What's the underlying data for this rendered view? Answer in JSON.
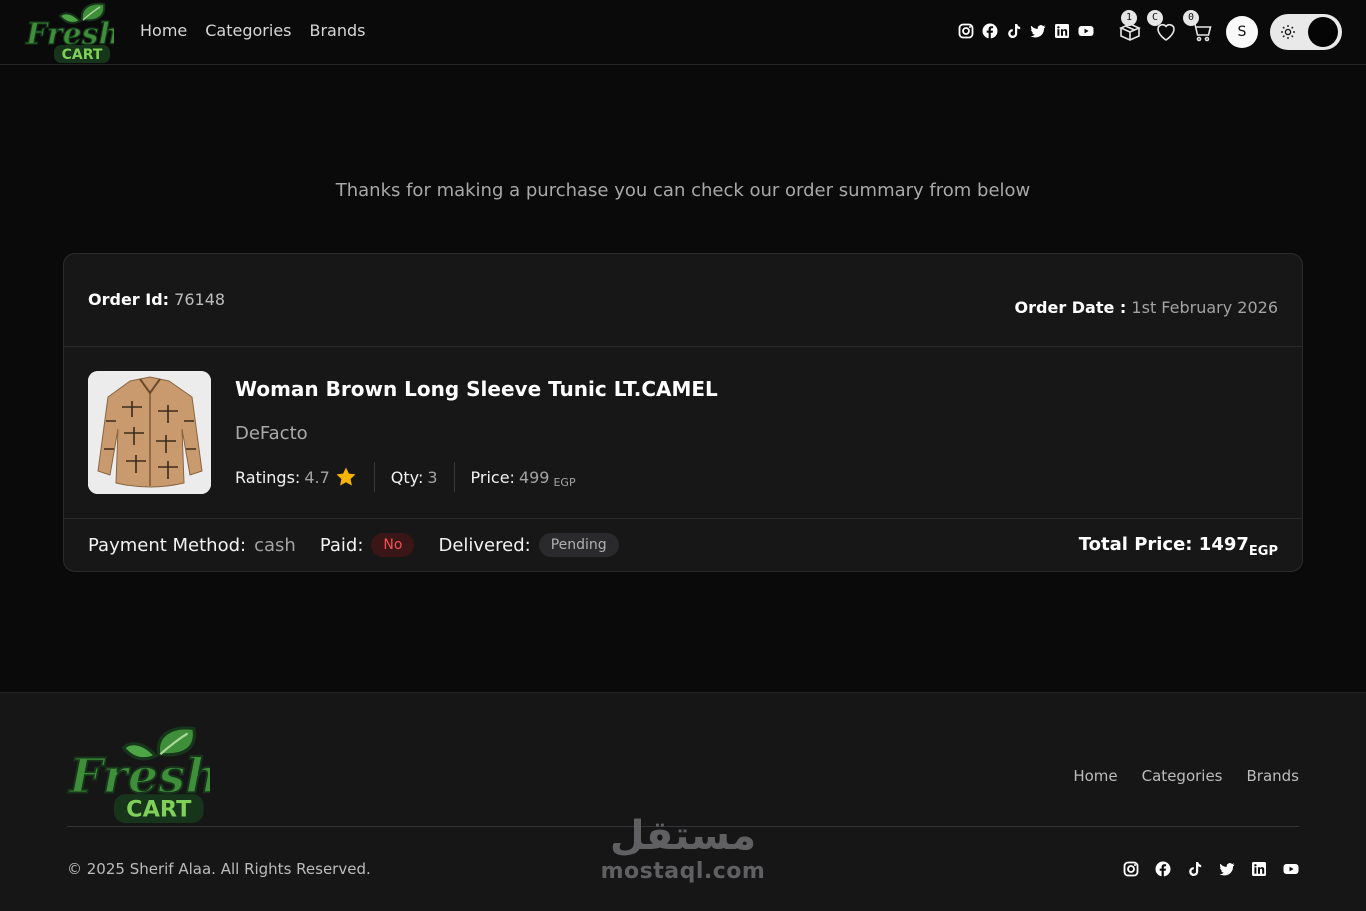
{
  "brand": {
    "logo_word_top": "Fresh",
    "logo_word_bottom": "CART",
    "colors": {
      "logo_green": "#3f8f3a",
      "logo_dark": "#16351a",
      "accent_red": "#f05252",
      "star": "#f6b400"
    }
  },
  "nav": {
    "links": [
      "Home",
      "Categories",
      "Brands"
    ],
    "socials": [
      "instagram-icon",
      "facebook-icon",
      "tiktok-icon",
      "twitter-icon",
      "linkedin-icon",
      "youtube-icon"
    ],
    "orders_count": "1",
    "wishlist_count": "C",
    "cart_count": "0",
    "avatar_initial": "S",
    "theme": "dark"
  },
  "main": {
    "thanks_message": "Thanks for making a purchase you can check our order summary from below",
    "order": {
      "id_label": "Order Id:",
      "id": "76148",
      "date_label": "Order Date :",
      "date": "1st February 2026",
      "item": {
        "title": "Woman Brown Long Sleeve Tunic LT.CAMEL",
        "brand": "DeFacto",
        "ratings_label": "Ratings:",
        "rating": "4.7",
        "qty_label": "Qty:",
        "qty": "3",
        "price_label": "Price:",
        "price": "499",
        "currency": "EGP"
      },
      "payment_label": "Payment Method:",
      "payment_method": "cash",
      "paid_label": "Paid:",
      "paid_status": "No",
      "delivered_label": "Delivered:",
      "delivered_status": "Pending",
      "total_label": "Total Price:",
      "total": "1497",
      "currency": "EGP"
    }
  },
  "footer": {
    "links": [
      "Home",
      "Categories",
      "Brands"
    ],
    "copyright": "© 2025 Sherif Alaa. All Rights Reserved.",
    "socials": [
      "instagram-icon",
      "facebook-icon",
      "tiktok-icon",
      "twitter-icon",
      "linkedin-icon",
      "youtube-icon"
    ]
  },
  "watermark": {
    "arabic": "مستقل",
    "latin": "mostaql.com"
  }
}
